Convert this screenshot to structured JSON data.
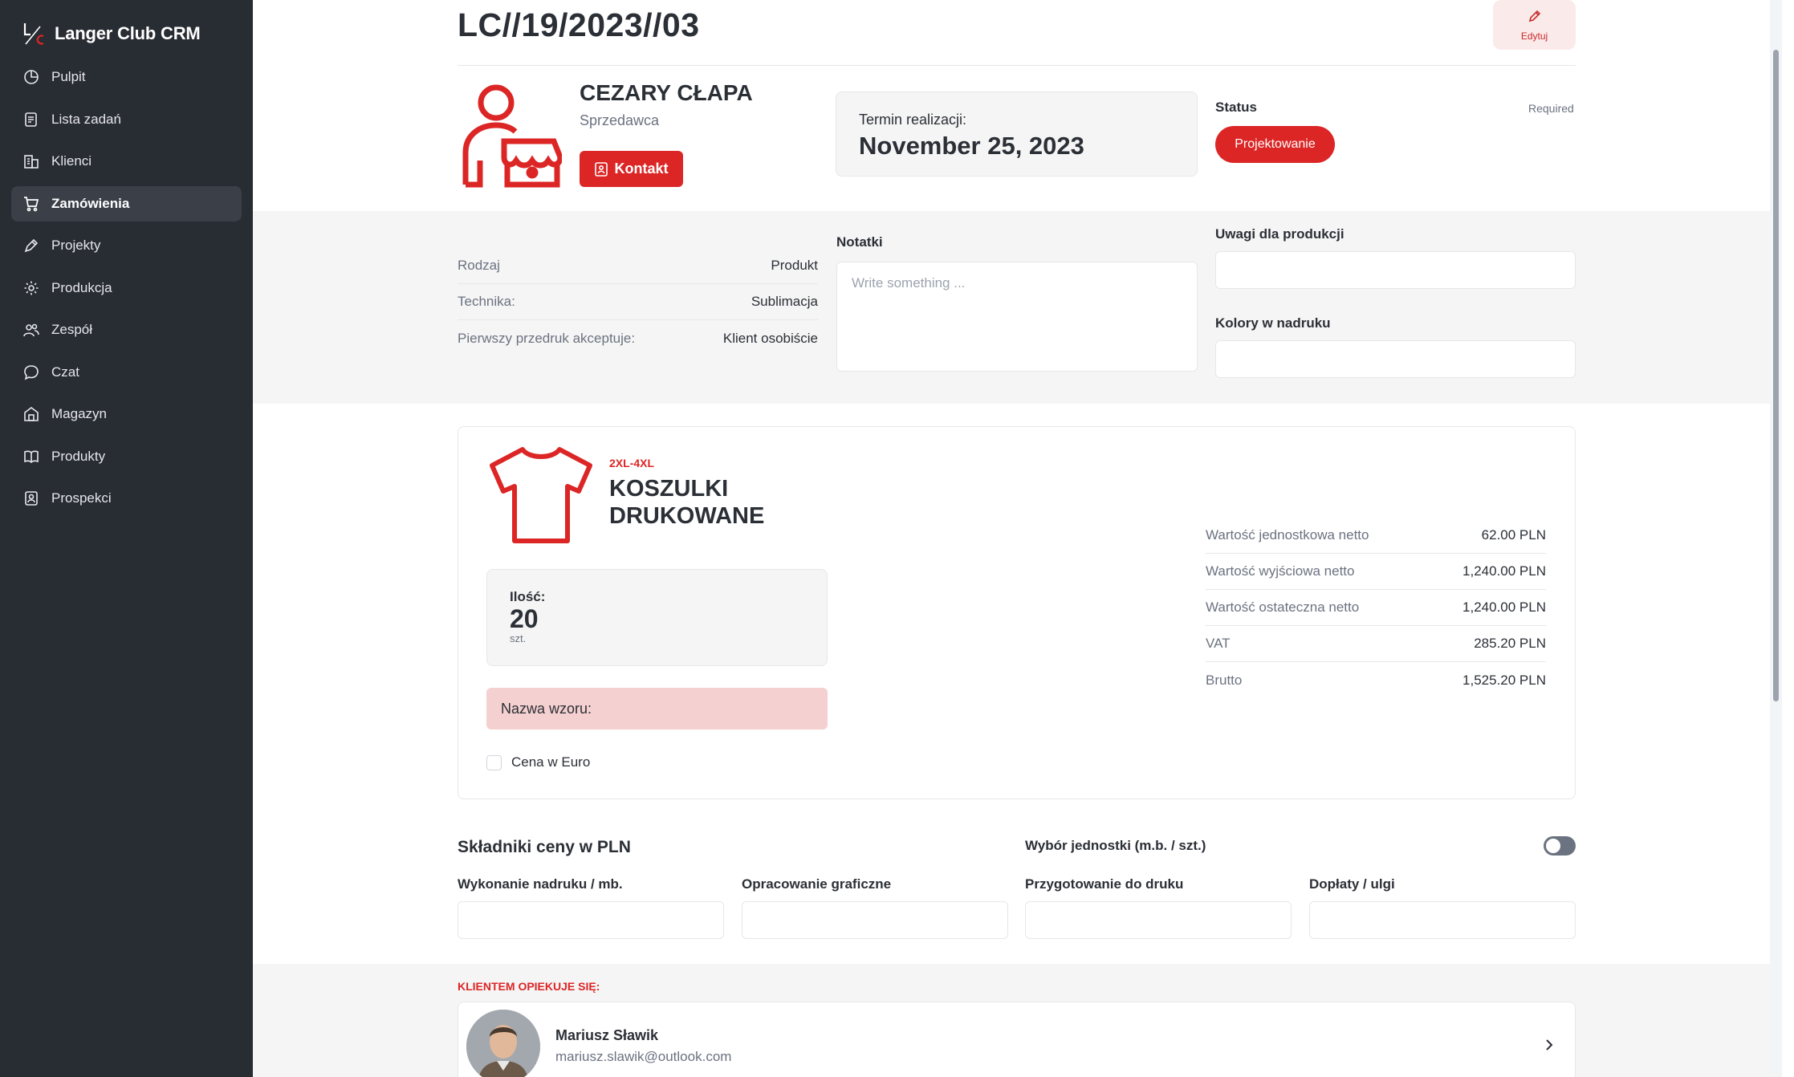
{
  "sidebar": {
    "brand_name": "Langer Club CRM",
    "items": [
      {
        "label": "Pulpit",
        "icon": "dashboard-icon",
        "active": false
      },
      {
        "label": "Lista zadań",
        "icon": "task-list-icon",
        "active": false
      },
      {
        "label": "Klienci",
        "icon": "clients-icon",
        "active": false
      },
      {
        "label": "Zamówienia",
        "icon": "cart-icon",
        "active": true
      },
      {
        "label": "Projekty",
        "icon": "pen-icon",
        "active": false
      },
      {
        "label": "Produkcja",
        "icon": "gear-icon",
        "active": false
      },
      {
        "label": "Zespół",
        "icon": "team-icon",
        "active": false
      },
      {
        "label": "Czat",
        "icon": "chat-icon",
        "active": false
      },
      {
        "label": "Magazyn",
        "icon": "warehouse-icon",
        "active": false
      },
      {
        "label": "Produkty",
        "icon": "book-icon",
        "active": false
      },
      {
        "label": "Prospekci",
        "icon": "badge-icon",
        "active": false
      }
    ]
  },
  "header": {
    "order_number": "LC//19/2023//03",
    "edit_label": "Edytuj"
  },
  "seller": {
    "name": "CEZARY CŁAPA",
    "role": "Sprzedawca",
    "contact_label": "Kontakt"
  },
  "deadline": {
    "label": "Termin realizacji:",
    "value": "November 25, 2023"
  },
  "status": {
    "label": "Status",
    "required": "Required",
    "value": "Projektowanie"
  },
  "details": [
    {
      "key": "Rodzaj",
      "value": "Produkt"
    },
    {
      "key": "Technika:",
      "value": "Sublimacja"
    },
    {
      "key": "Pierwszy przedruk akceptuje:",
      "value": "Klient osobiście"
    }
  ],
  "notes": {
    "label": "Notatki",
    "placeholder": "Write something ..."
  },
  "production_notes": {
    "label": "Uwagi dla produkcji",
    "value": ""
  },
  "print_colors": {
    "label": "Kolory w nadruku",
    "value": ""
  },
  "product": {
    "sizes": "2XL-4XL",
    "name": "KOSZULKI DRUKOWANE",
    "quantity_label": "Ilość:",
    "quantity": "20",
    "quantity_unit": "szt.",
    "pattern_label": "Nazwa wzoru:",
    "euro_label": "Cena w Euro",
    "euro_checked": false,
    "prices": [
      {
        "key": "Wartość jednostkowa netto",
        "value": "62.00 PLN"
      },
      {
        "key": "Wartość wyjściowa netto",
        "value": "1,240.00 PLN"
      },
      {
        "key": "Wartość ostateczna netto",
        "value": "1,240.00 PLN"
      },
      {
        "key": "VAT",
        "value": "285.20 PLN"
      },
      {
        "key": "Brutto",
        "value": "1,525.20 PLN"
      }
    ]
  },
  "price_components": {
    "title": "Składniki ceny w PLN",
    "unit_choice_label": "Wybór jednostki (m.b. / szt.)",
    "unit_toggle_on": false,
    "fields": [
      {
        "label": "Wykonanie nadruku / mb.",
        "value": ""
      },
      {
        "label": "Opracowanie graficzne",
        "value": ""
      },
      {
        "label": "Przygotowanie do druku",
        "value": ""
      },
      {
        "label": "Dopłaty / ulgi",
        "value": ""
      }
    ]
  },
  "caretaker": {
    "label": "KLIENTEM OPIEKUJE SIĘ:",
    "name": "Mariusz Sławik",
    "email": "mariusz.slawik@outlook.com"
  },
  "colors": {
    "accent": "#dc2626",
    "sidebar_bg": "#282c33",
    "sidebar_active": "#3a3f48",
    "pattern_bg": "#f5d0d0"
  }
}
